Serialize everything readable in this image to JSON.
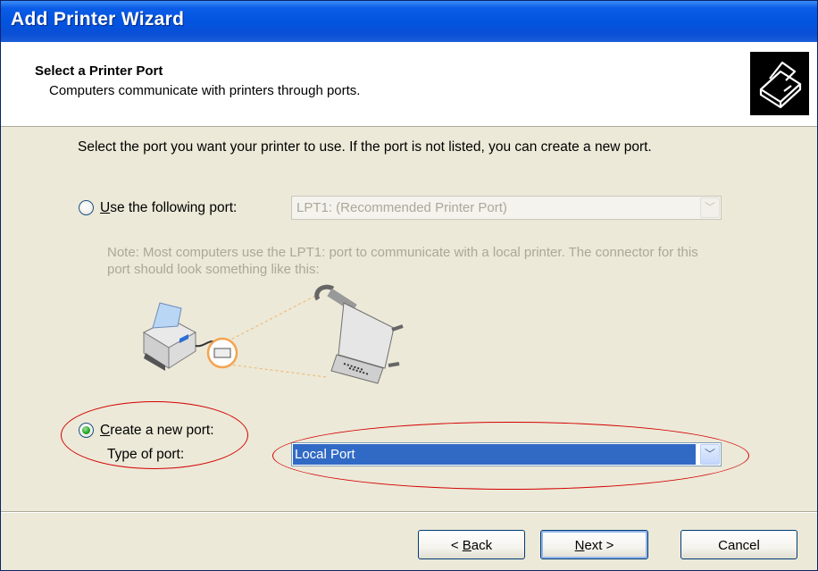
{
  "window": {
    "title": "Add Printer Wizard"
  },
  "header": {
    "title": "Select a Printer Port",
    "subtitle": "Computers communicate with printers through ports."
  },
  "content": {
    "instruction": "Select the port you want your printer to use.  If the port is not listed, you can create a new port.",
    "use_port": {
      "label_mnemonic": "U",
      "label_rest": "se the following port:",
      "selected": false,
      "combo_value": "LPT1: (Recommended Printer Port)",
      "enabled": false
    },
    "note": "Note: Most computers use the LPT1: port to communicate with a local printer. The connector for this port should look something like this:",
    "create_port": {
      "label_mnemonic": "C",
      "label_rest": "reate a new port:",
      "selected": true,
      "type_label": "Type of port:",
      "combo_value": "Local Port"
    }
  },
  "buttons": {
    "back_mnemonic": "B",
    "back_rest": "ack",
    "back_prefix": "< ",
    "next_mnemonic": "N",
    "next_rest": "ext >",
    "cancel": "Cancel"
  },
  "colors": {
    "title_bar": "#0254E0",
    "selection": "#316AC5",
    "annotation": "#D40000",
    "port_highlight": "#F2A552"
  }
}
